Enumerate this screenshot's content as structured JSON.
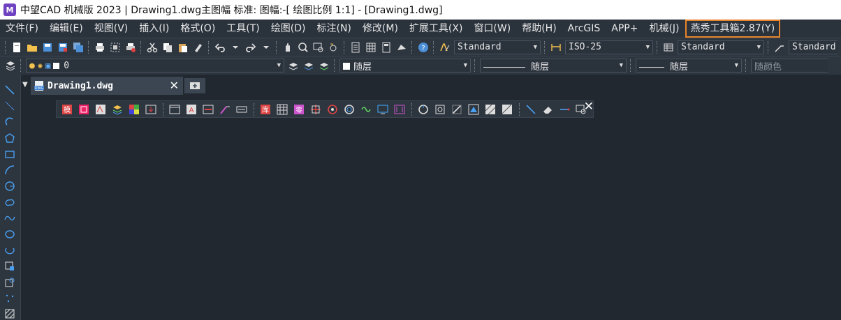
{
  "window": {
    "logo_text": "M",
    "title": "中望CAD 机械版 2023 | Drawing1.dwg主图幅  标准: 图幅:-[ 绘图比例 1:1] - [Drawing1.dwg]"
  },
  "menu": {
    "items": [
      "文件(F)",
      "编辑(E)",
      "视图(V)",
      "插入(I)",
      "格式(O)",
      "工具(T)",
      "绘图(D)",
      "标注(N)",
      "修改(M)",
      "扩展工具(X)",
      "窗口(W)",
      "帮助(H)",
      "ArcGIS",
      "APP+",
      "机械(J)",
      "燕秀工具箱2.87(Y)"
    ],
    "highlighted": "燕秀工具箱2.87(Y)",
    "highlight_color": "#e8842c"
  },
  "toolbar": {
    "text_style": "Standard",
    "dim_style": "ISO-25",
    "table_style": "Standard",
    "multileader_style": "Standard",
    "layer": "0",
    "color": "随层",
    "linetype": "随层",
    "lineweight": "随层",
    "plotstyle": "随颜色"
  },
  "tabs": {
    "active_label": "Drawing1.dwg"
  },
  "colors": {
    "background": "#212830",
    "menubar": "#2a323c",
    "toolbar": "#2d353f"
  }
}
